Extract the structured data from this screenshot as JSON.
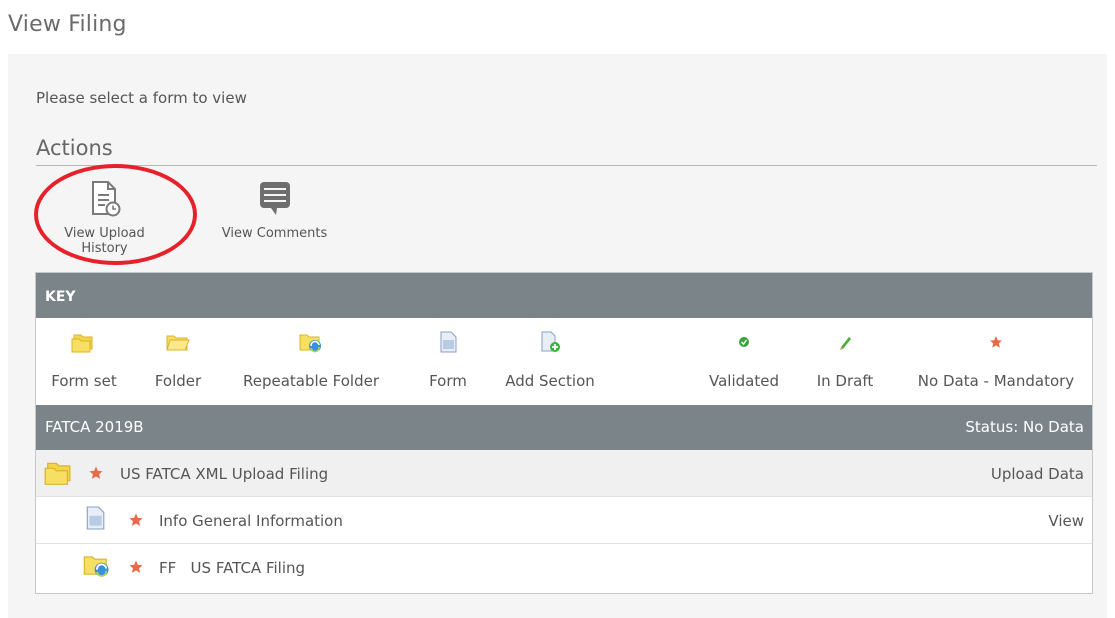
{
  "page": {
    "title": "View Filing"
  },
  "panel": {
    "instruction": "Please select a form to view",
    "actions_heading": "Actions",
    "actions": [
      {
        "label": "View Upload History",
        "icon": "upload-history-icon"
      },
      {
        "label": "View Comments",
        "icon": "comments-icon"
      }
    ]
  },
  "key": {
    "title": "KEY",
    "items": [
      {
        "label": "Form set",
        "icon": "form-set-icon"
      },
      {
        "label": "Folder",
        "icon": "folder-icon"
      },
      {
        "label": "Repeatable Folder",
        "icon": "repeatable-folder-icon"
      },
      {
        "label": "Form",
        "icon": "form-icon"
      },
      {
        "label": "Add Section",
        "icon": "add-section-icon"
      },
      {
        "label": "Validated",
        "icon": "validated-icon"
      },
      {
        "label": "In Draft",
        "icon": "in-draft-icon"
      },
      {
        "label": "No Data - Mandatory",
        "icon": "no-data-mandatory-icon"
      }
    ]
  },
  "filing": {
    "name": "FATCA 2019B",
    "status": "Status: No Data",
    "rows": [
      {
        "label": "US FATCA XML Upload Filing",
        "action": "Upload Data",
        "icon": "form-set-icon"
      },
      {
        "label": "Info General Information",
        "action": "View",
        "icon": "form-icon"
      },
      {
        "label": "FF   US FATCA Filing",
        "action": "",
        "icon": "repeatable-folder-icon"
      }
    ]
  },
  "colors": {
    "bar": "#7b8589",
    "highlight_circle": "#e5222a",
    "star": "#e86a4a",
    "validated": "#3aa33a",
    "draft": "#3e9d3e"
  }
}
